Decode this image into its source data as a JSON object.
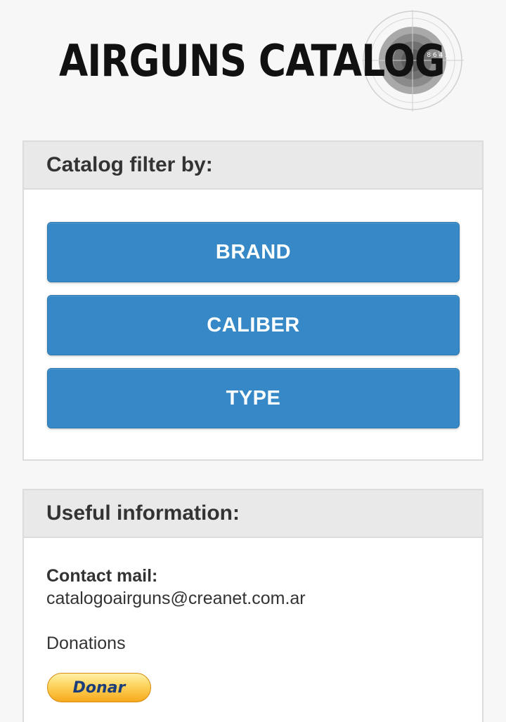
{
  "logo": {
    "text": "AIRGUNS CATALOG",
    "target_numbers": "10 8 6 4 2"
  },
  "filter_panel": {
    "title": "Catalog filter by:",
    "buttons": [
      {
        "label": "BRAND"
      },
      {
        "label": "CALIBER"
      },
      {
        "label": "TYPE"
      }
    ]
  },
  "info_panel": {
    "title": "Useful information:",
    "contact_label": "Contact mail:",
    "contact_mail": "catalogoairguns@creanet.com.ar",
    "donations_label": "Donations",
    "donate_button": "Donar"
  },
  "colors": {
    "button_blue": "#3689c6",
    "header_gray": "#e9e9e9",
    "page_bg": "#f7f7f7"
  }
}
